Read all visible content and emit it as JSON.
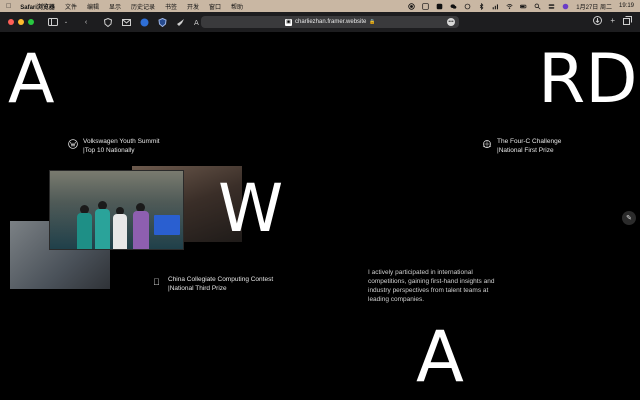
{
  "menubar": {
    "app_name": "Safari浏览器",
    "items": [
      "文件",
      "编辑",
      "显示",
      "历史记录",
      "书签",
      "开发",
      "窗口",
      "帮助"
    ],
    "date": "1月27日 周二",
    "time": "19:19"
  },
  "toolbar": {
    "url": "charliezhan.framer.website"
  },
  "page": {
    "big_letters": {
      "a1": "A",
      "rd": "RD",
      "w": "W",
      "a2": "A"
    },
    "awards": {
      "vw": {
        "line1": "Volkswagen Youth Summit",
        "line2": "|Top 10 Nationally"
      },
      "fourc": {
        "line1": "The Four-C Challenge",
        "line2": "|National First Prize"
      },
      "ccc": {
        "line1": "China Collegiate Computing Contest",
        "line2": "|National Third Prize"
      }
    },
    "description": "I actively participated in international competitions, gaining first-hand insights and industry perspectives from talent teams at leading companies."
  },
  "colors": {
    "menubar_bg": "#c9b7a3",
    "toolbar_bg": "#1d1d1f",
    "page_bg": "#000000",
    "traffic_red": "#ff5f57",
    "traffic_yellow": "#febc2e",
    "traffic_green": "#28c840"
  }
}
